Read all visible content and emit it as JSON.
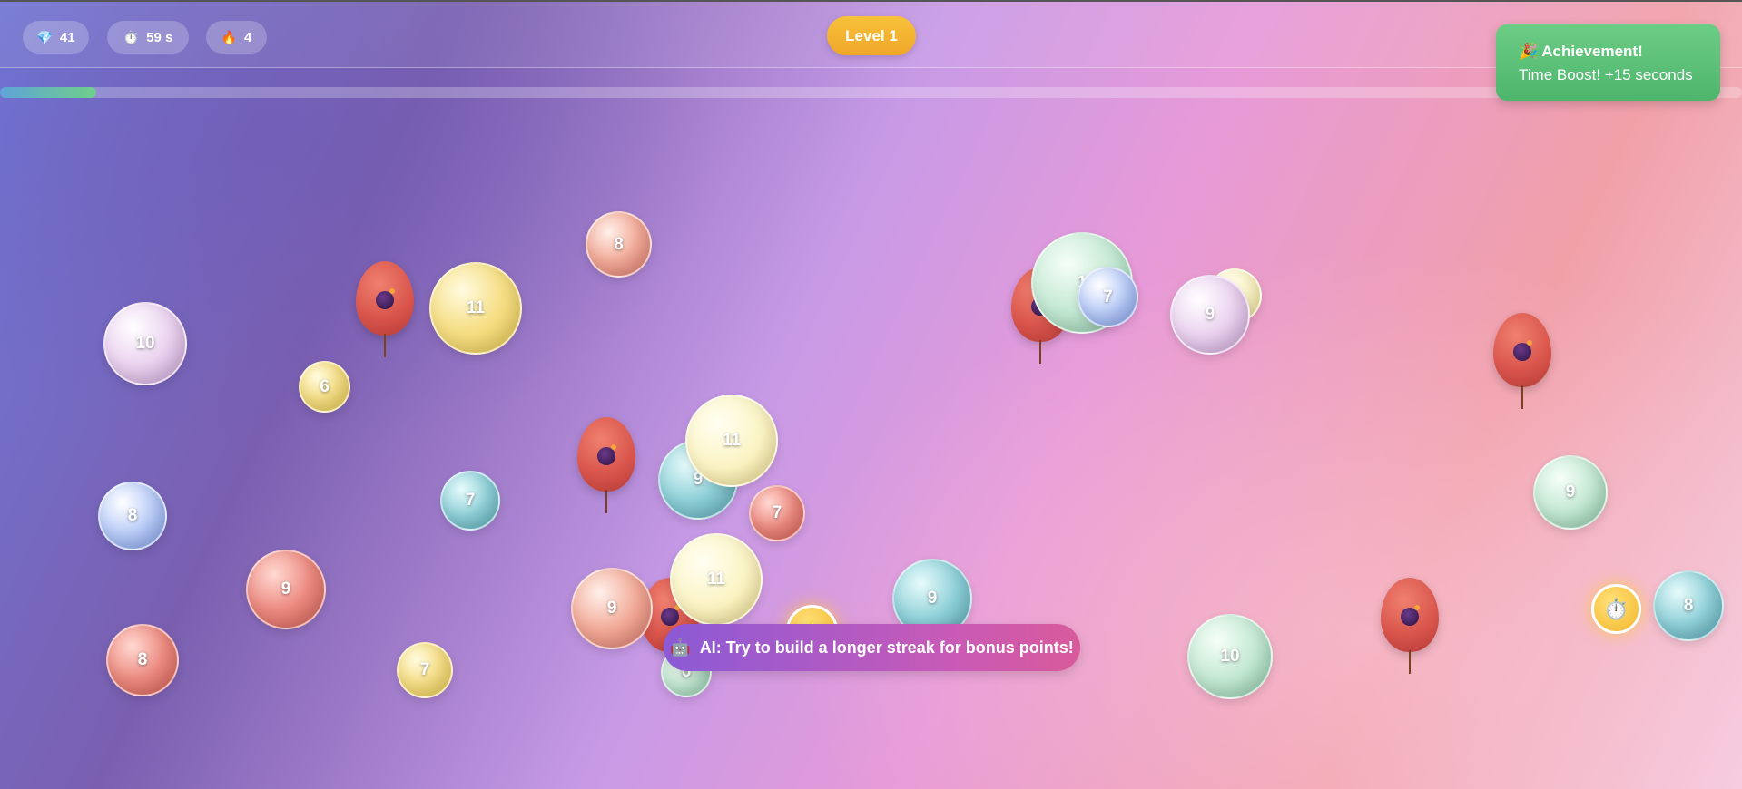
{
  "stats": {
    "gems": {
      "icon": "💎",
      "value": "41"
    },
    "timer": {
      "icon": "⏱️",
      "value": "59 s"
    },
    "streak": {
      "icon": "🔥",
      "value": "4"
    }
  },
  "level_label": "Level 1",
  "progress_fraction": 0.055,
  "achievement": {
    "title": "🎉 Achievement!",
    "message": "Time Boost! +15 seconds"
  },
  "ai_tip": {
    "icon": "🤖",
    "text": "AI: Try to build a longer streak for bonus points!"
  },
  "powerups": [
    {
      "icon": "⏱️"
    },
    {
      "icon": "⭐"
    }
  ],
  "bubble_values": [
    "10",
    "11",
    "8",
    "6",
    "8",
    "7",
    "9",
    "8",
    "9",
    "11",
    "9",
    "7",
    "9",
    "6",
    "11",
    "7",
    "9",
    "1",
    "7",
    "9",
    "10",
    "9",
    "8"
  ],
  "colors": {
    "level_pill": "#f4b52a",
    "achievement": "#5cc27a",
    "progress": "#6fd08a",
    "ai_tip": "#a35ad0"
  }
}
